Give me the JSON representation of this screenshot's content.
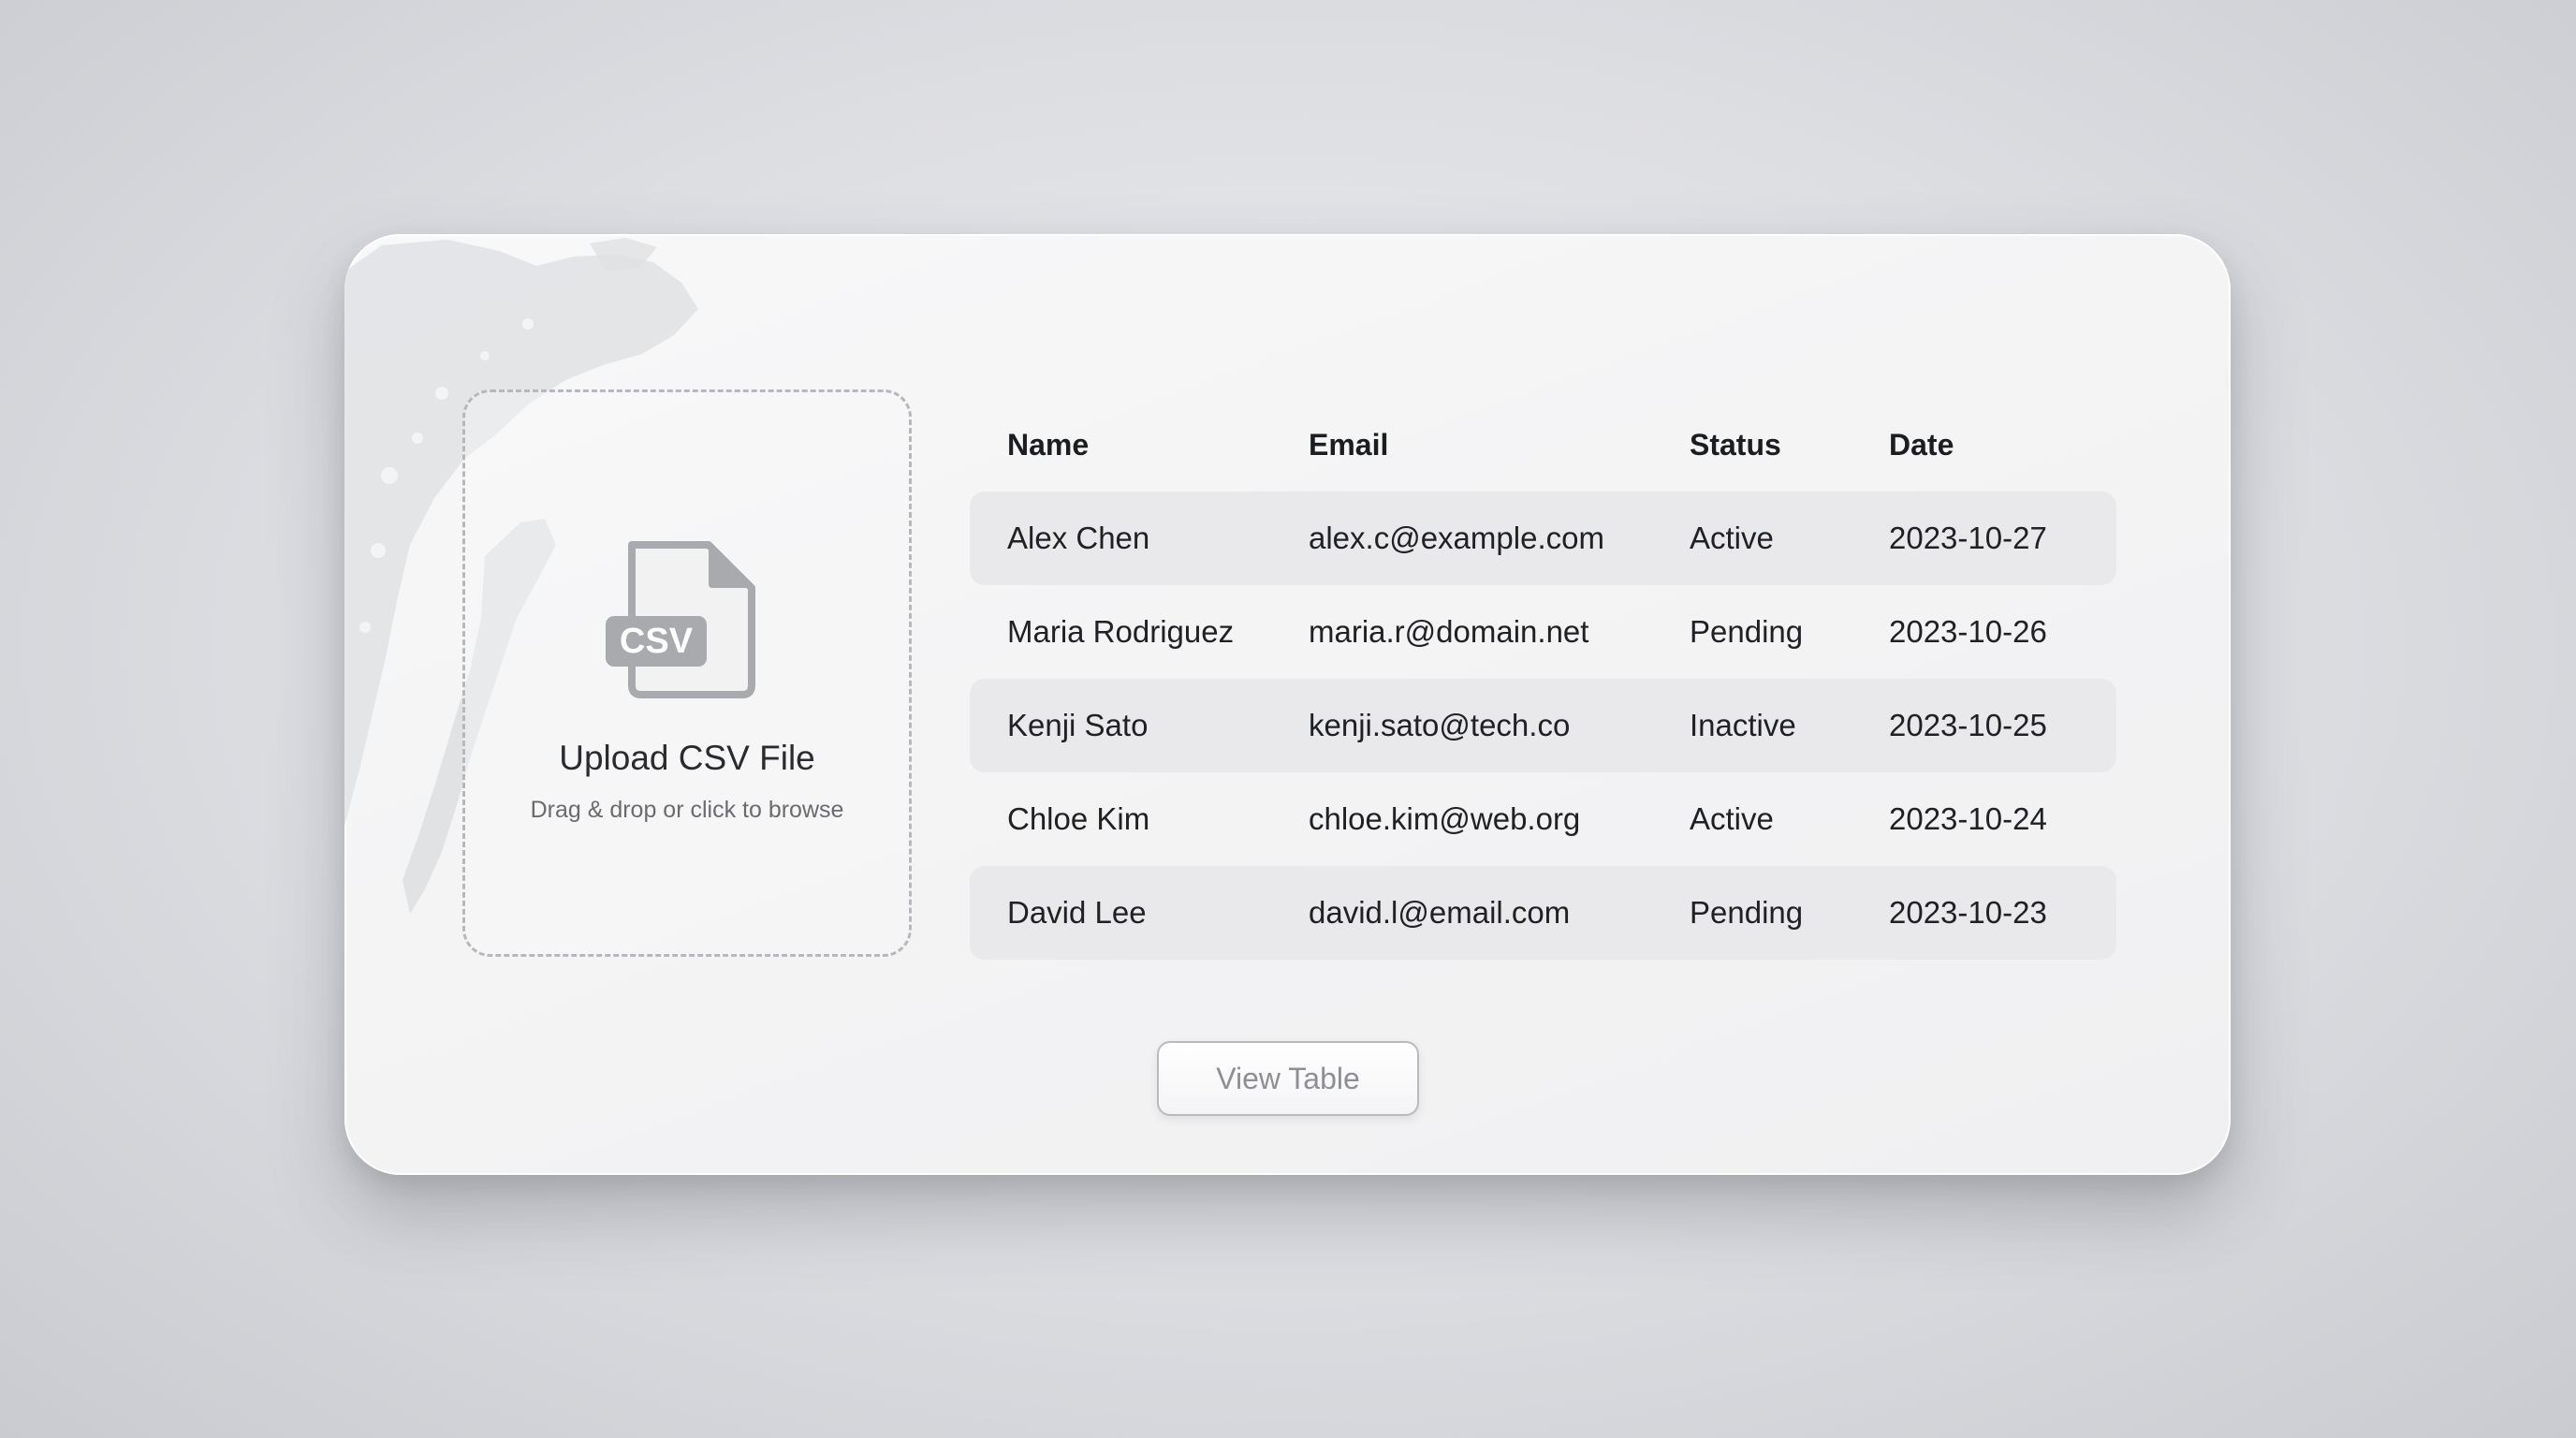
{
  "upload": {
    "icon_label": "CSV",
    "title": "Upload CSV File",
    "hint": "Drag & drop or click to browse"
  },
  "table": {
    "headers": {
      "name": "Name",
      "email": "Email",
      "status": "Status",
      "date": "Date"
    },
    "rows": [
      {
        "name": "Alex Chen",
        "email": "alex.c@example.com",
        "status": "Active",
        "date": "2023-10-27"
      },
      {
        "name": "Maria Rodriguez",
        "email": "maria.r@domain.net",
        "status": "Pending",
        "date": "2023-10-26"
      },
      {
        "name": "Kenji Sato",
        "email": "kenji.sato@tech.co",
        "status": "Inactive",
        "date": "2023-10-25"
      },
      {
        "name": "Chloe Kim",
        "email": "chloe.kim@web.org",
        "status": "Active",
        "date": "2023-10-24"
      },
      {
        "name": "David Lee",
        "email": "david.l@email.com",
        "status": "Pending",
        "date": "2023-10-23"
      }
    ]
  },
  "actions": {
    "view_table_label": "View Table"
  },
  "colors": {
    "card": "#f5f5f6",
    "row_shade": "#e9e9ec",
    "icon_gray": "#a9aaae",
    "text_dark": "#202124"
  }
}
